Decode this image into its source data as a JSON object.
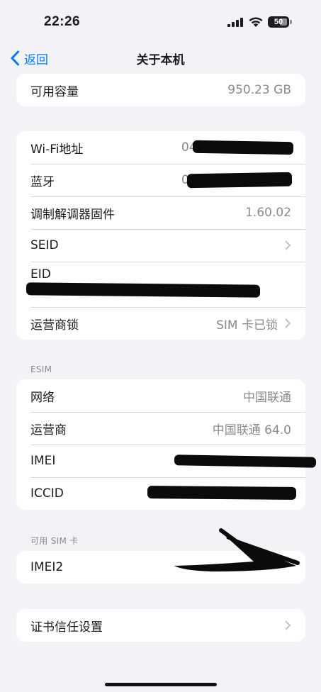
{
  "status": {
    "time": "22:26",
    "battery": "50"
  },
  "nav": {
    "back_label": "返回",
    "title": "关于本机"
  },
  "capacity": {
    "label": "可用容量",
    "value": "950.23 GB"
  },
  "network_group": {
    "wifi_label": "Wi-Fi地址",
    "wifi_value_prefix": "04",
    "bluetooth_label": "蓝牙",
    "bluetooth_value_prefix": "0",
    "modem_label": "调制解调器固件",
    "modem_value": "1.60.02",
    "seid_label": "SEID",
    "eid_label": "EID",
    "carrier_lock_label": "运营商锁",
    "carrier_lock_value": "SIM 卡已锁"
  },
  "esim": {
    "header": "ESIM",
    "network_label": "网络",
    "network_value": "中国联通",
    "carrier_label": "运营商",
    "carrier_value": "中国联通 64.0",
    "imei_label": "IMEI",
    "iccid_label": "ICCID"
  },
  "sim": {
    "header": "可用 SIM 卡",
    "imei2_label": "IMEI2"
  },
  "trust": {
    "label": "证书信任设置"
  },
  "colors": {
    "accent": "#007aff",
    "background": "#f2f2f7",
    "secondary_text": "#8a8a8e"
  }
}
